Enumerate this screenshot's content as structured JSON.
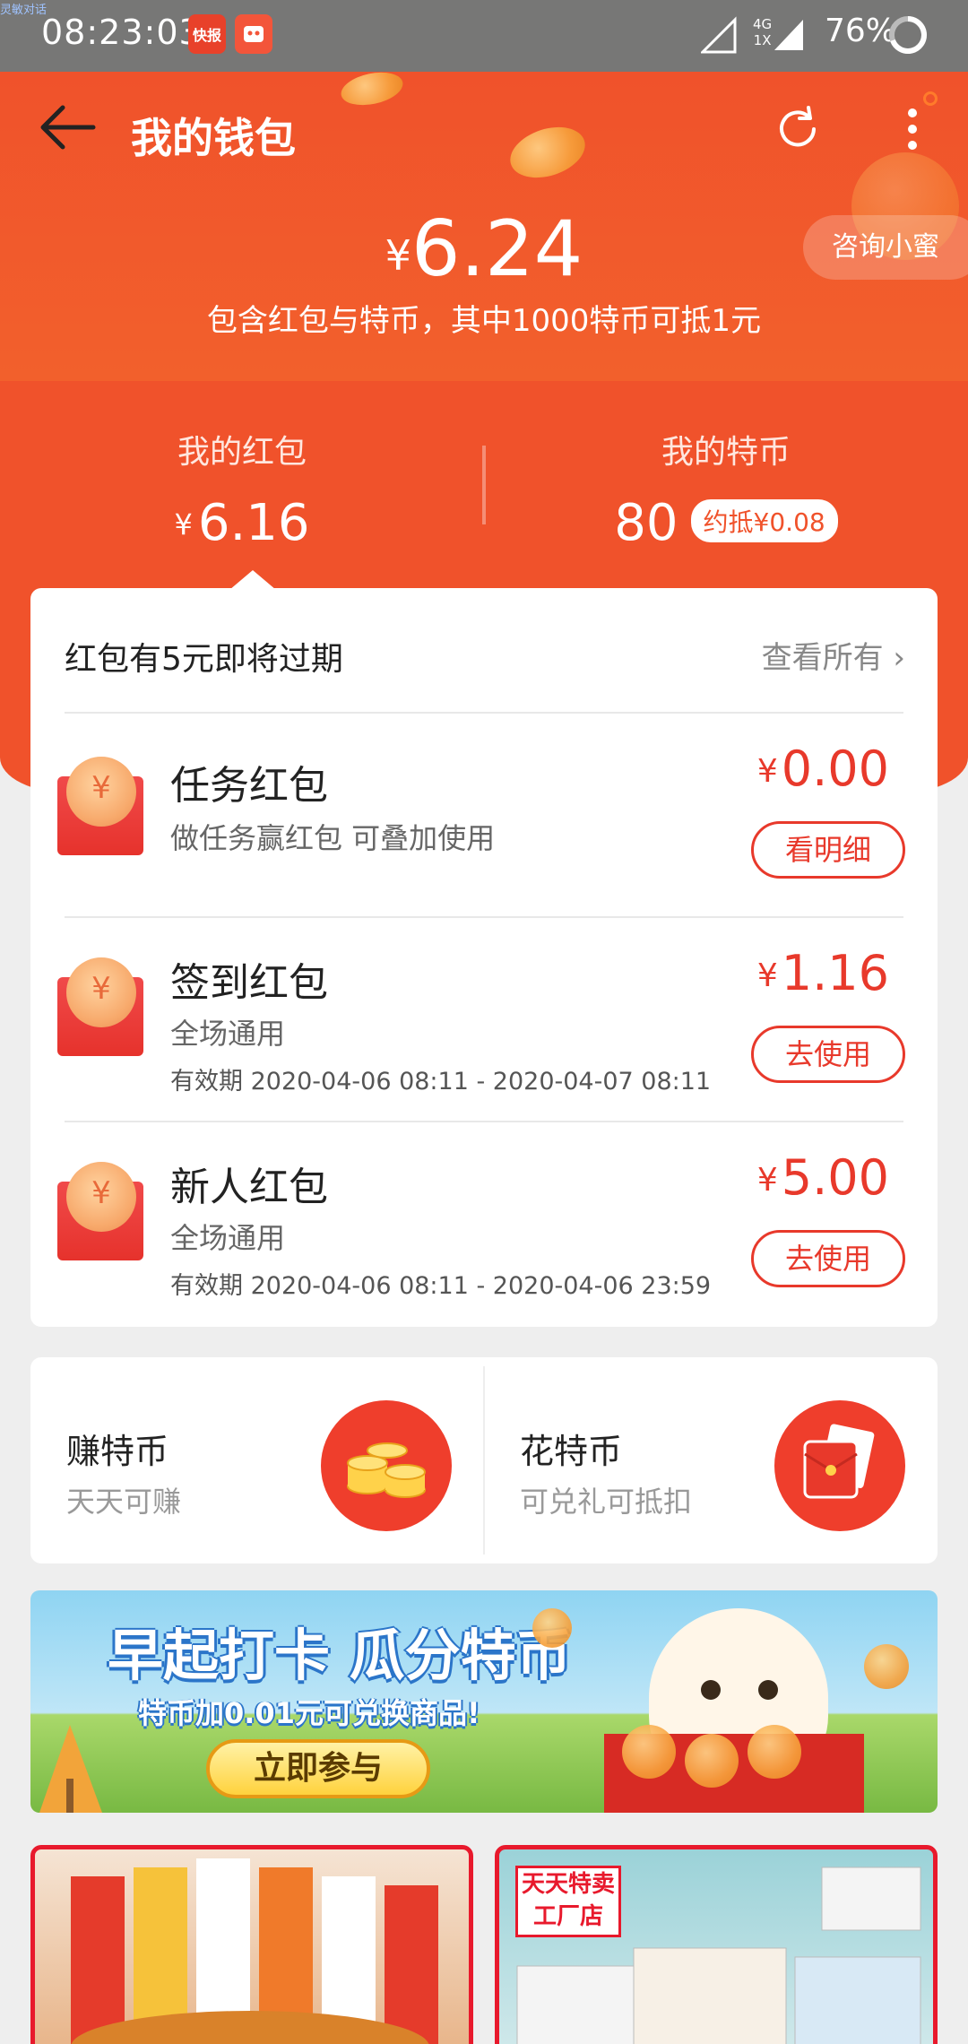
{
  "status_bar": {
    "time": "08:23:03",
    "tiny_text": "灵敏对话",
    "app_badge_1": "快报",
    "network_top": "4G",
    "network_bottom": "1X",
    "battery": "76%"
  },
  "nav": {
    "title": "我的钱包"
  },
  "wallet": {
    "currency": "¥",
    "total": "6.24",
    "note": "包含红包与特币，其中1000特币可抵1元",
    "consult_label": "咨询小蜜"
  },
  "summary": {
    "red_packets_label": "我的红包",
    "red_packets_value": "6.16",
    "coins_label": "我的特币",
    "coins_value": "80",
    "coins_equiv": "约抵¥0.08"
  },
  "red_packets": {
    "expiry_notice": "红包有5元即将过期",
    "view_all": "查看所有 ›",
    "items": [
      {
        "title": "任务红包",
        "subtitle": "做任务赢红包 可叠加使用",
        "validity": "",
        "amount": "0.00",
        "button": "看明细"
      },
      {
        "title": "签到红包",
        "subtitle": "全场通用",
        "validity": "有效期 2020-04-06 08:11 - 2020-04-07 08:11",
        "amount": "1.16",
        "button": "去使用"
      },
      {
        "title": "新人红包",
        "subtitle": "全场通用",
        "validity": "有效期 2020-04-06 08:11 - 2020-04-06 23:59",
        "amount": "5.00",
        "button": "去使用"
      }
    ]
  },
  "coins": {
    "earn_title": "赚特币",
    "earn_sub": "天天可赚",
    "spend_title": "花特币",
    "spend_sub": "可兑礼可抵扣"
  },
  "banner": {
    "headline": "早起打卡 瓜分特币",
    "sub": "特币加0.01元可兑换商品!",
    "cta": "立即参与"
  },
  "tiles": {
    "right_label": "天天特卖 工厂店"
  },
  "colors": {
    "brand_red": "#f0522b",
    "accent_red": "#e8392b"
  }
}
